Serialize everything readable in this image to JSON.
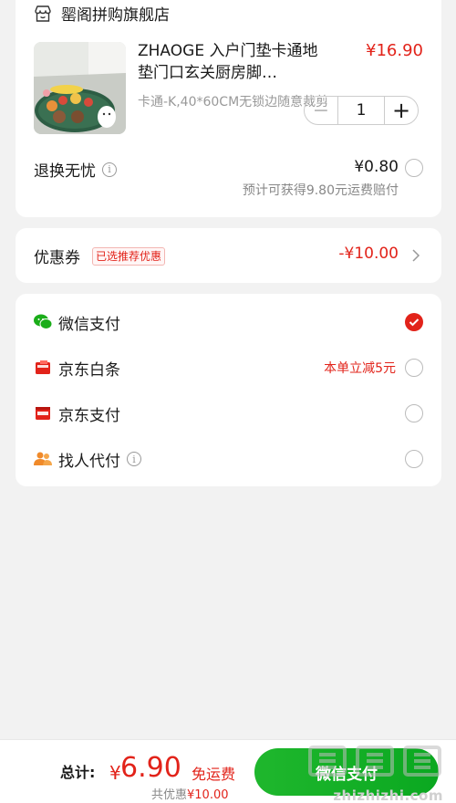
{
  "store": {
    "name": "罂阁拼购旗舰店"
  },
  "product": {
    "title": "ZHAOGE 入户门垫卡通地垫门口玄关厨房脚…",
    "price": "¥16.90",
    "spec": "卡通-K,40*60CM无锁边随意裁剪",
    "quantity": "1",
    "minus_label": "−",
    "plus_label": "+"
  },
  "refund": {
    "label": "退换无忧",
    "price": "¥0.80",
    "note": "预计可获得9.80元运费赔付"
  },
  "coupon": {
    "label": "优惠券",
    "tag": "已选推荐优惠",
    "value": "-¥10.00"
  },
  "payment": {
    "options": [
      {
        "label": "微信支付",
        "selected": true,
        "promo": ""
      },
      {
        "label": "京东白条",
        "selected": false,
        "promo": "本单立减5元"
      },
      {
        "label": "京东支付",
        "selected": false,
        "promo": ""
      },
      {
        "label": "找人代付",
        "selected": false,
        "promo": ""
      }
    ]
  },
  "bottom": {
    "total_label": "总计:",
    "yen": "¥",
    "total_value": "6.90",
    "free_shipping": "免运费",
    "discount_prefix": "共优惠",
    "discount_value": "¥10.00",
    "pay_button": "微信支付"
  },
  "watermark": {
    "url": "zhizhizhi.com",
    "logo_text": "值值值"
  },
  "colors": {
    "accent_red": "#e2231a",
    "wechat_green": "#1aad19",
    "background": "#f2f2f2"
  }
}
